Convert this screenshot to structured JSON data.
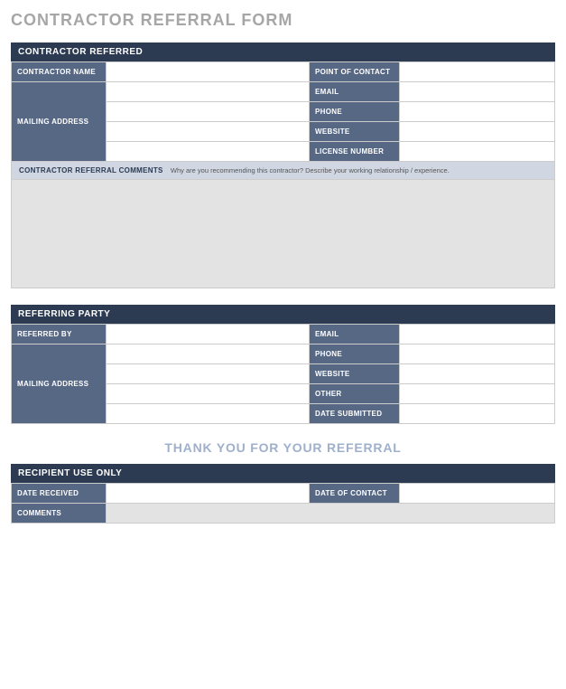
{
  "title": "CONTRACTOR REFERRAL FORM",
  "section1": {
    "header": "CONTRACTOR REFERRED",
    "labels": {
      "contractor_name": "CONTRACTOR NAME",
      "mailing_address": "MAILING ADDRESS",
      "point_of_contact": "POINT OF CONTACT",
      "email": "EMAIL",
      "phone": "PHONE",
      "website": "WEBSITE",
      "license_number": "LICENSE NUMBER"
    },
    "comments_label": "CONTRACTOR REFERRAL COMMENTS",
    "comments_hint": "Why are you recommending this contractor? Describe your working relationship / experience."
  },
  "section2": {
    "header": "REFERRING PARTY",
    "labels": {
      "referred_by": "REFERRED BY",
      "mailing_address": "MAILING ADDRESS",
      "email": "EMAIL",
      "phone": "PHONE",
      "website": "WEBSITE",
      "other": "OTHER",
      "date_submitted": "DATE SUBMITTED"
    }
  },
  "thanks": "THANK YOU FOR YOUR REFERRAL",
  "section3": {
    "header": "RECIPIENT USE ONLY",
    "labels": {
      "date_received": "DATE RECEIVED",
      "date_of_contact": "DATE OF CONTACT",
      "comments": "COMMENTS"
    }
  }
}
